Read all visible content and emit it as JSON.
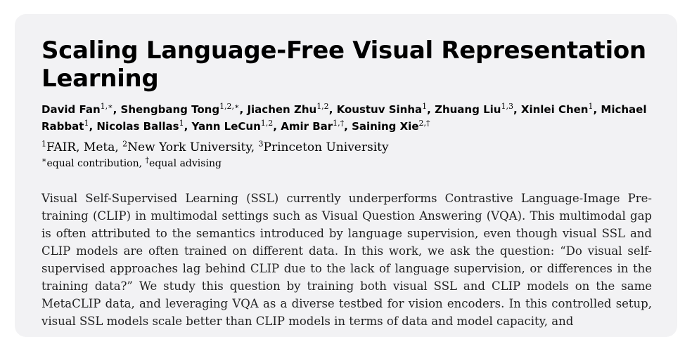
{
  "paper": {
    "title": "Scaling Language-Free Visual Representation Learning",
    "authors": [
      {
        "name": "David Fan",
        "sup": "1,∗",
        "sep": ", "
      },
      {
        "name": "Shengbang Tong",
        "sup": "1,2,∗",
        "sep": ", "
      },
      {
        "name": "Jiachen Zhu",
        "sup": "1,2",
        "sep": ", "
      },
      {
        "name": "Koustuv Sinha",
        "sup": "1",
        "sep": ", "
      },
      {
        "name": "Zhuang Liu",
        "sup": "1,3",
        "sep": ", "
      },
      {
        "name": "Xinlei Chen",
        "sup": "1",
        "sep": ", "
      },
      {
        "name": "Michael Rabbat",
        "sup": "1",
        "sep": ", "
      },
      {
        "name": "Nicolas Ballas",
        "sup": "1",
        "sep": ", "
      },
      {
        "name": "Yann LeCun",
        "sup": "1,2",
        "sep": ", "
      },
      {
        "name": "Amir Bar",
        "sup": "1,†",
        "sep": ", "
      },
      {
        "name": "Saining Xie",
        "sup": "2,†",
        "sep": ""
      }
    ],
    "affiliations": [
      {
        "sup": "1",
        "name": "FAIR, Meta",
        "sep": ", "
      },
      {
        "sup": "2",
        "name": "New York University",
        "sep": ", "
      },
      {
        "sup": "3",
        "name": "Princeton University",
        "sep": ""
      }
    ],
    "notes": [
      {
        "sup": "∗",
        "text": "equal contribution",
        "sep": ", "
      },
      {
        "sup": "†",
        "text": "equal advising",
        "sep": ""
      }
    ],
    "abstract": "Visual Self-Supervised Learning (SSL) currently underperforms Contrastive Language-Image Pre-training (CLIP) in multimodal settings such as Visual Question Answering (VQA). This multimodal gap is often attributed to the semantics introduced by language supervision, even though visual SSL and CLIP models are often trained on different data. In this work, we ask the question: “Do visual self-supervised approaches lag behind CLIP due to the lack of language supervision, or differences in the training data?” We study this question by training both visual SSL and CLIP models on the same MetaCLIP data, and leveraging VQA as a diverse testbed for vision encoders. In this controlled setup, visual SSL models scale better than CLIP models in terms of data and model capacity, and"
  }
}
